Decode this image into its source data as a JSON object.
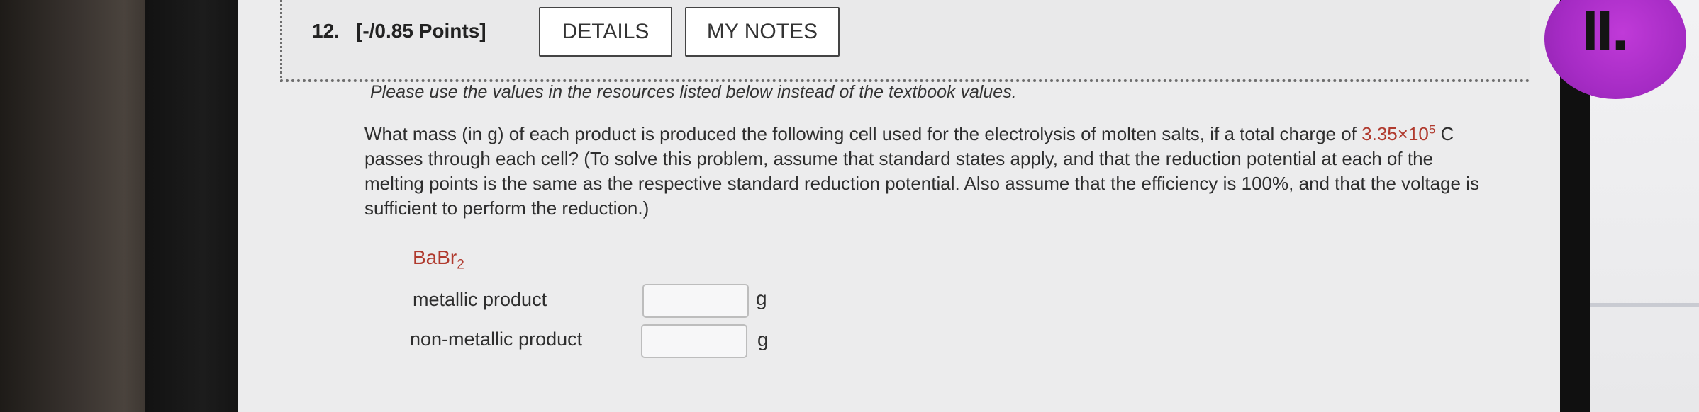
{
  "question": {
    "number": "12.",
    "points": "[-/0.85 Points]",
    "details_label": "DETAILS",
    "my_notes_label": "MY NOTES"
  },
  "instruction": "Please use the values in the resources listed below instead of the textbook values.",
  "problem": {
    "part1": "What mass (in g) of each product is produced the following cell used for the electrolysis of molten salts, if a total charge of",
    "charge_mantissa": "3.35",
    "charge_times": "×",
    "charge_base": "10",
    "charge_exponent": "5",
    "part2": " C passes through each cell? (To solve this problem, assume that standard states apply, and that the reduction potential at each of the melting points is the same as the respective standard reduction potential. Also assume that the efficiency is 100%, and that the voltage is sufficient to perform the reduction.)"
  },
  "compound": {
    "base": "BaBr",
    "subscript": "2"
  },
  "rows": {
    "metallic_label": "metallic product",
    "metallic_value": "",
    "metallic_unit": "g",
    "nonmetallic_label": "non-metallic product",
    "nonmetallic_value": "",
    "nonmetallic_unit": "g"
  },
  "sticker_text": "ll.",
  "colors": {
    "accent_red": "#b03a2e",
    "sticker_purple": "#b030cc"
  }
}
